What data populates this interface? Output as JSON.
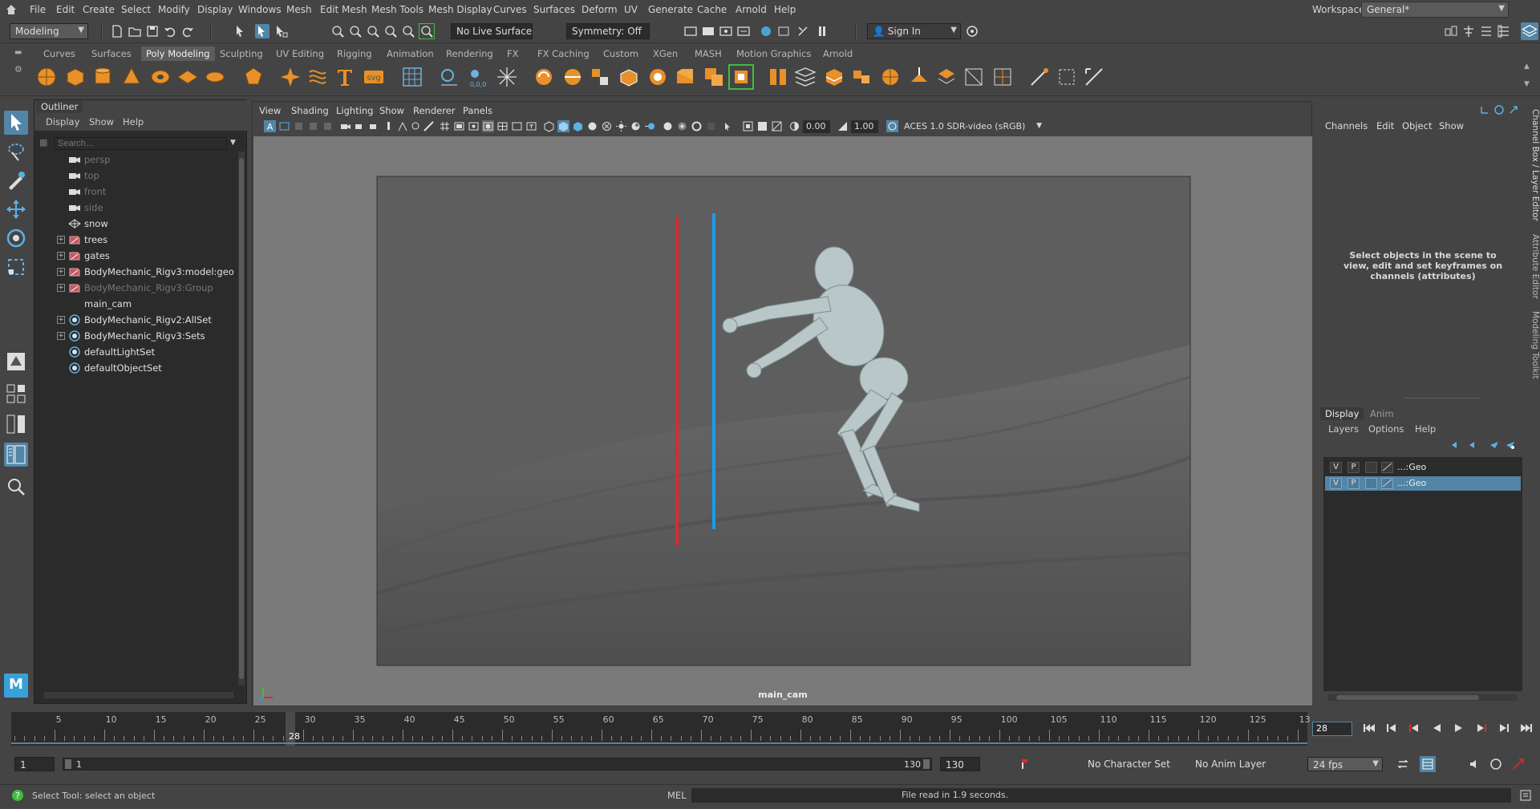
{
  "menubar": {
    "items": [
      "File",
      "Edit",
      "Create",
      "Select",
      "Modify",
      "Display",
      "Windows",
      "Mesh",
      "Edit Mesh",
      "Mesh Tools",
      "Mesh Display",
      "Curves",
      "Surfaces",
      "Deform",
      "UV",
      "Generate",
      "Cache",
      "Arnold",
      "Help"
    ],
    "workspace_label": "Workspace:",
    "workspace_value": "General*"
  },
  "statusline": {
    "menuset": "Modeling",
    "live_surface": "No Live Surface",
    "symmetry": "Symmetry: Off",
    "sign_in": "Sign In"
  },
  "shelf": {
    "tabs": [
      "Curves",
      "Surfaces",
      "Poly Modeling",
      "Sculpting",
      "UV Editing",
      "Rigging",
      "Animation",
      "Rendering",
      "FX",
      "FX Caching",
      "Custom",
      "XGen",
      "MASH",
      "Motion Graphics",
      "Arnold"
    ],
    "active_tab": "Poly Modeling"
  },
  "outliner": {
    "title": "Outliner",
    "menu": [
      "Display",
      "Show",
      "Help"
    ],
    "search_placeholder": "Search...",
    "items": [
      {
        "label": "persp",
        "icon": "camera-icon",
        "expandable": false,
        "dim": true
      },
      {
        "label": "top",
        "icon": "camera-icon",
        "expandable": false,
        "dim": true
      },
      {
        "label": "front",
        "icon": "camera-icon",
        "expandable": false,
        "dim": true
      },
      {
        "label": "side",
        "icon": "camera-icon",
        "expandable": false,
        "dim": true
      },
      {
        "label": "snow",
        "icon": "mesh-icon",
        "expandable": false,
        "dim": false
      },
      {
        "label": "trees",
        "icon": "group-icon",
        "expandable": true,
        "dim": false
      },
      {
        "label": "gates",
        "icon": "group-icon",
        "expandable": true,
        "dim": false
      },
      {
        "label": "BodyMechanic_Rigv3:model:geo",
        "icon": "group-icon",
        "expandable": true,
        "dim": false
      },
      {
        "label": "BodyMechanic_Rigv3:Group",
        "icon": "group-icon",
        "expandable": true,
        "dim": true
      },
      {
        "label": "main_cam",
        "icon": "none",
        "expandable": false,
        "dim": false
      },
      {
        "label": "BodyMechanic_Rigv2:AllSet",
        "icon": "set-icon",
        "expandable": true,
        "dim": false
      },
      {
        "label": "BodyMechanic_Rigv3:Sets",
        "icon": "set-icon",
        "expandable": true,
        "dim": false
      },
      {
        "label": "defaultLightSet",
        "icon": "set-icon",
        "expandable": false,
        "dim": false
      },
      {
        "label": "defaultObjectSet",
        "icon": "set-icon",
        "expandable": false,
        "dim": false
      }
    ]
  },
  "viewport": {
    "menu": [
      "View",
      "Shading",
      "Lighting",
      "Show",
      "Renderer",
      "Panels"
    ],
    "exposure": "0.00",
    "gamma": "1.00",
    "color_space": "ACES 1.0 SDR-video (sRGB)",
    "camera_label": "main_cam"
  },
  "channelbox": {
    "menu": [
      "Channels",
      "Edit",
      "Object",
      "Show"
    ],
    "info": "Select objects in the scene to view, edit and set keyframes on channels (attributes)"
  },
  "sidetabs": [
    "Channel Box / Layer Editor",
    "Attribute Editor",
    "Modeling Toolkit"
  ],
  "layereditor": {
    "tabs": [
      "Display",
      "Anim"
    ],
    "active_tab": "Display",
    "menu": [
      "Layers",
      "Options",
      "Help"
    ],
    "layers": [
      {
        "v": "V",
        "p": "P",
        "name": "...:Geo",
        "selected": false
      },
      {
        "v": "V",
        "p": "P",
        "name": "...:Geo",
        "selected": true
      }
    ]
  },
  "timeline": {
    "labels": [
      "5",
      "10",
      "15",
      "20",
      "25",
      "30",
      "35",
      "40",
      "45",
      "50",
      "55",
      "60",
      "65",
      "70",
      "75",
      "80",
      "85",
      "90",
      "95",
      "100",
      "105",
      "110",
      "115",
      "120",
      "125",
      "13"
    ],
    "current_frame": "28",
    "current_frame_field": "28"
  },
  "range": {
    "anim_start": "1",
    "range_start": "1",
    "range_end": "130",
    "anim_end": "130",
    "character_set": "No Character Set",
    "anim_layer": "No Anim Layer",
    "fps": "24 fps"
  },
  "statusbar": {
    "help": "Select Tool: select an object",
    "mel_label": "MEL",
    "result": "File read in  1.9 seconds."
  },
  "colors": {
    "accent": "#5285a6",
    "red_pole": "#e0282c",
    "blue_pole": "#1e9be8",
    "character": "#b9c7c9"
  }
}
